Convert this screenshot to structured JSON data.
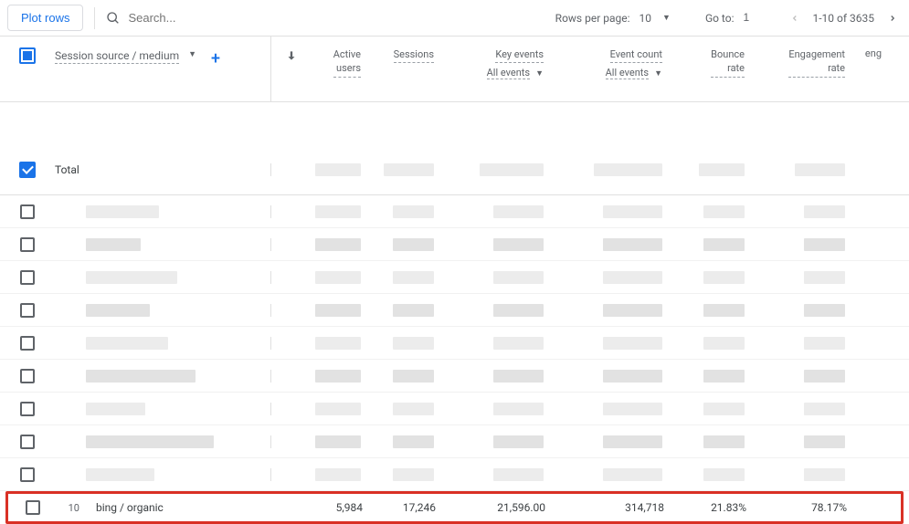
{
  "toolbar": {
    "plot_label": "Plot rows",
    "search_placeholder": "Search...",
    "rows_per_page_label": "Rows per page:",
    "rows_per_page_value": "10",
    "goto_label": "Go to:",
    "goto_value": "1",
    "range_text": "1-10 of 3635"
  },
  "header": {
    "dimension_label": "Session source / medium",
    "metrics": {
      "active_users": "Active\nusers",
      "sessions": "Sessions",
      "key_events": "Key events",
      "key_events_sub": "All events",
      "event_count": "Event count",
      "event_count_sub": "All events",
      "bounce_rate": "Bounce\nrate",
      "engagement_rate": "Engagement\nrate",
      "extra": "eng"
    }
  },
  "total_label": "Total",
  "row10": {
    "index": "10",
    "source": "bing / organic",
    "active_users": "5,984",
    "sessions": "17,246",
    "key_events": "21,596.00",
    "event_count": "314,718",
    "bounce_rate": "21.83%",
    "engagement_rate": "78.17%"
  }
}
